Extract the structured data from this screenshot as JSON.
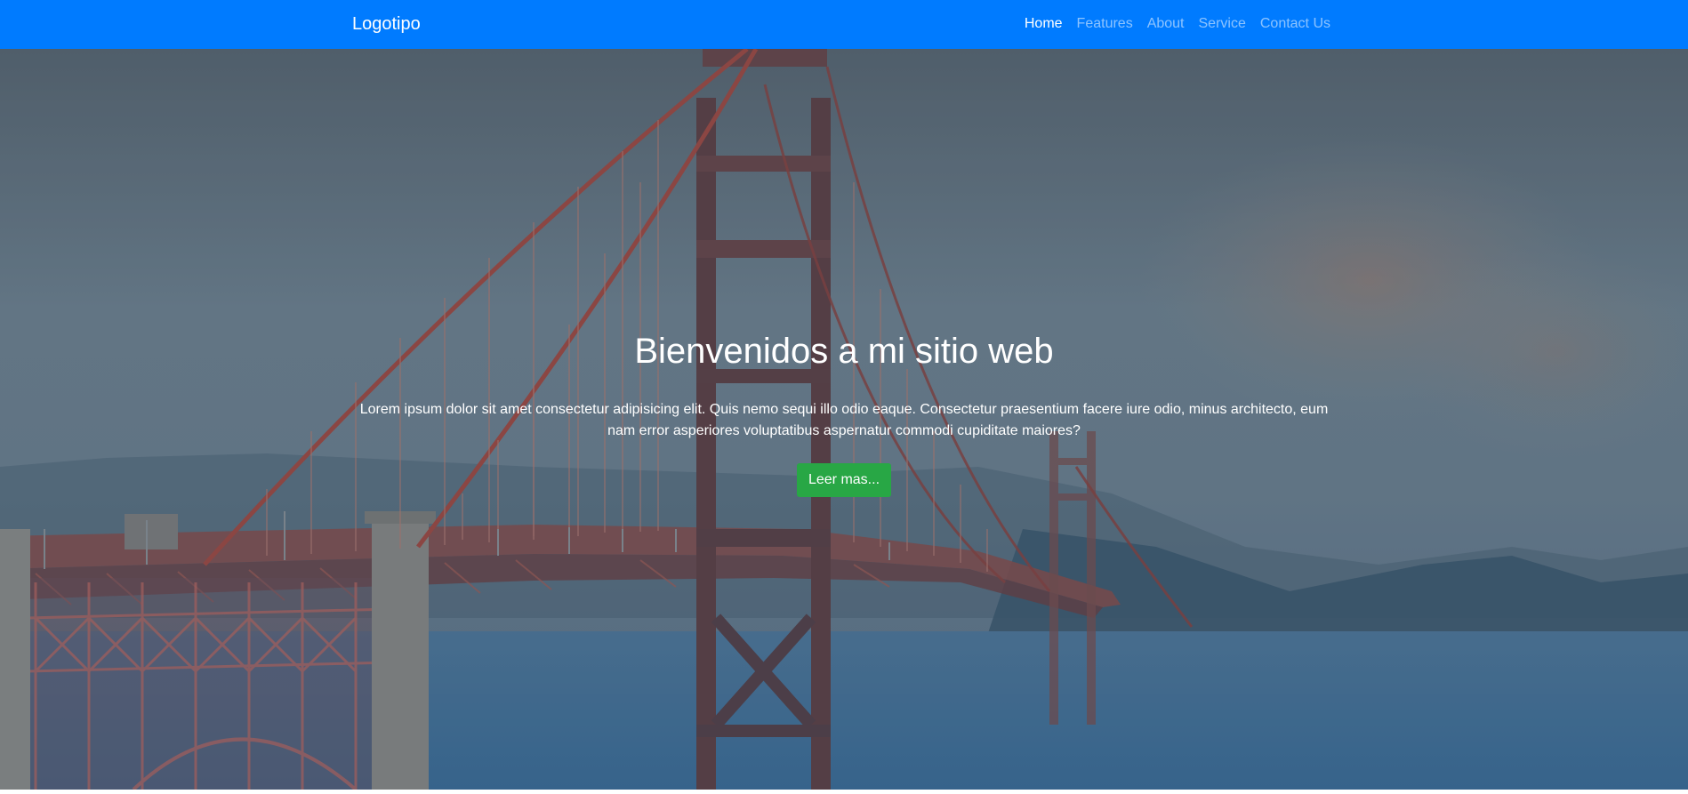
{
  "navbar": {
    "brand": "Logotipo",
    "background": "#007bff",
    "links": [
      {
        "label": "Home",
        "active": true
      },
      {
        "label": "Features",
        "active": false
      },
      {
        "label": "About",
        "active": false
      },
      {
        "label": "Service",
        "active": false
      },
      {
        "label": "Contact Us",
        "active": false
      }
    ]
  },
  "hero": {
    "background_image": "golden-gate-bridge-photo",
    "title": "Bienvenidos a mi sitio web",
    "text": "Lorem ipsum dolor sit amet consectetur adipisicing elit. Quis nemo sequi illo odio eaque. Consectetur praesentium facere iure odio, minus architecto, eum nam error asperiores voluptatibus aspernatur commodi cupiditate maiores?",
    "button_label": "Leer mas...",
    "button_color": "#28a745"
  }
}
